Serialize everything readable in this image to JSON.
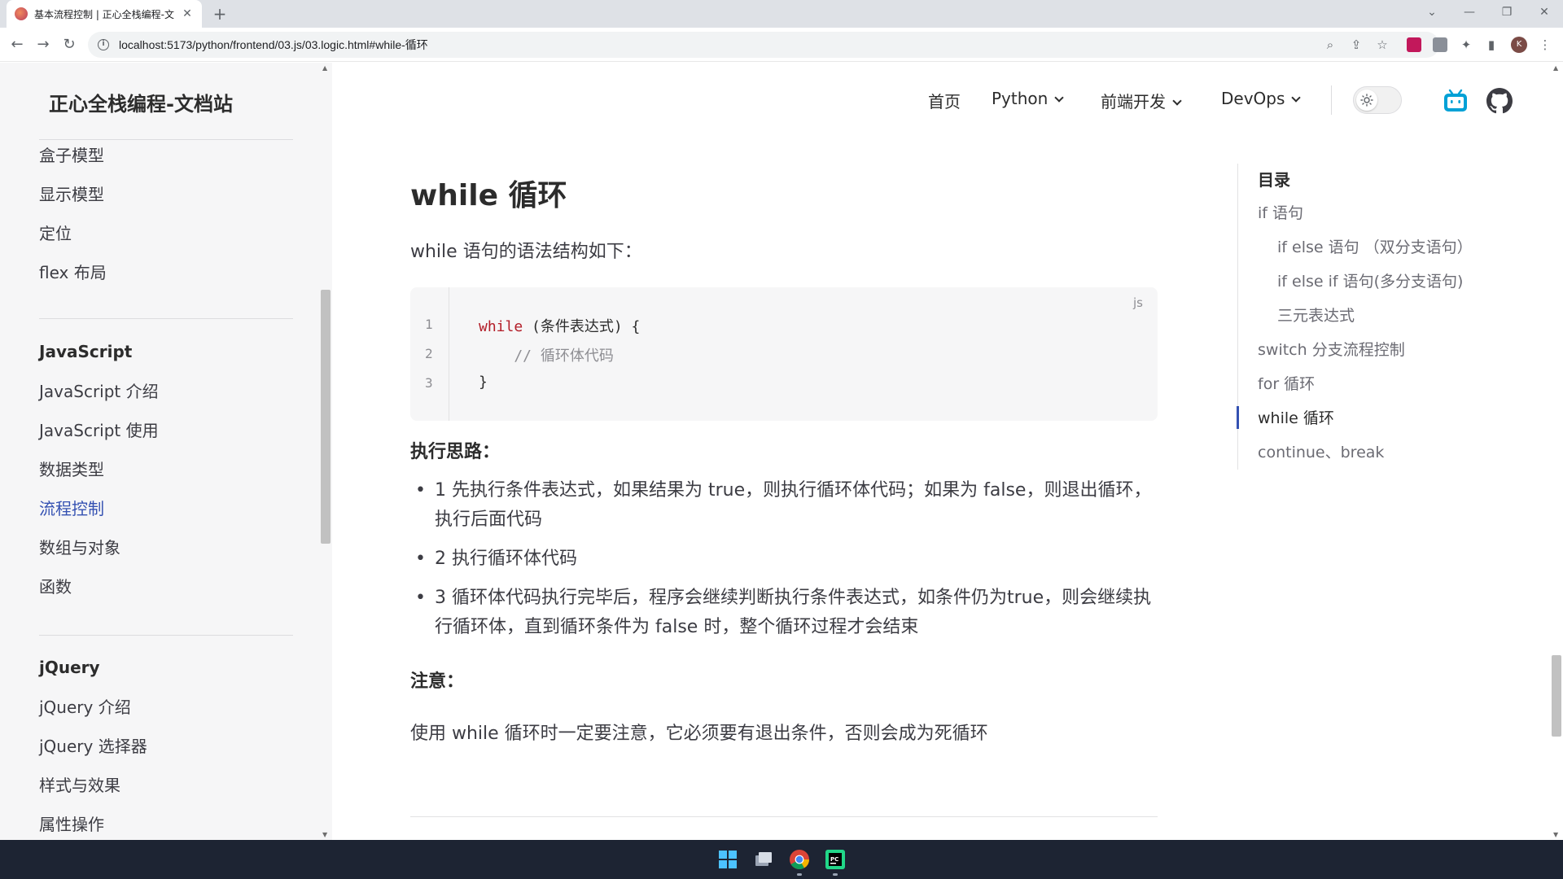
{
  "browser": {
    "tab_title": "基本流程控制 | 正心全栈编程-文档站",
    "tab_close": "✕",
    "new_tab": "+",
    "url": "localhost:5173/python/frontend/03.js/03.logic.html#while-循环",
    "profile_initial": "K"
  },
  "site": {
    "title": "正心全栈编程-文档站"
  },
  "sidebar": {
    "css_items": [
      {
        "label": "盒子模型"
      },
      {
        "label": "显示模型"
      },
      {
        "label": "定位"
      },
      {
        "label": "flex 布局"
      }
    ],
    "js_heading": "JavaScript",
    "js_items": [
      {
        "label": "JavaScript 介绍"
      },
      {
        "label": "JavaScript 使用"
      },
      {
        "label": "数据类型"
      },
      {
        "label": "流程控制",
        "active": true
      },
      {
        "label": "数组与对象"
      },
      {
        "label": "函数"
      }
    ],
    "jquery_heading": "jQuery",
    "jquery_items": [
      {
        "label": "jQuery 介绍"
      },
      {
        "label": "jQuery 选择器"
      },
      {
        "label": "样式与效果"
      },
      {
        "label": "属性操作"
      }
    ]
  },
  "nav": {
    "home": "首页",
    "python": "Python",
    "frontend": "前端开发",
    "devops": "DevOps"
  },
  "article": {
    "heading": "while 循环",
    "intro": "while 语句的语法结构如下：",
    "code_lang": "js",
    "code_line_numbers": [
      "1",
      "2",
      "3"
    ],
    "code_keyword": "while",
    "code_line1_rest": " (条件表达式) {",
    "code_line2": "    // 循环体代码",
    "code_line3": "}",
    "steps_heading": "执行思路：",
    "steps": [
      "1 先执行条件表达式，如果结果为 true，则执行循环体代码；如果为 false，则退出循环，执行后面代码",
      "2 执行循环体代码",
      "3 循环体代码执行完毕后，程序会继续判断执行条件表达式，如条件仍为true，则会继续执行循环体，直到循环条件为 false 时，整个循环过程才会结束"
    ],
    "note_heading": "注意：",
    "note": "使用 while 循环时一定要注意，它必须要有退出条件，否则会成为死循环"
  },
  "toc": {
    "title": "目录",
    "items": [
      {
        "label": "if 语句",
        "level": 1
      },
      {
        "label": "if else 语句 （双分支语句）",
        "level": 2
      },
      {
        "label": "if else if 语句(多分支语句)",
        "level": 2
      },
      {
        "label": "三元表达式",
        "level": 2
      },
      {
        "label": "switch 分支流程控制",
        "level": 1
      },
      {
        "label": "for 循环",
        "level": 1
      },
      {
        "label": "while 循环",
        "level": 1,
        "active": true
      },
      {
        "label": "continue、break",
        "level": 1
      }
    ]
  },
  "colors": {
    "accent": "#3451b2",
    "keyword": "#b31d28",
    "bilibili": "#00a1d6",
    "taskbar": "#1d2433"
  }
}
